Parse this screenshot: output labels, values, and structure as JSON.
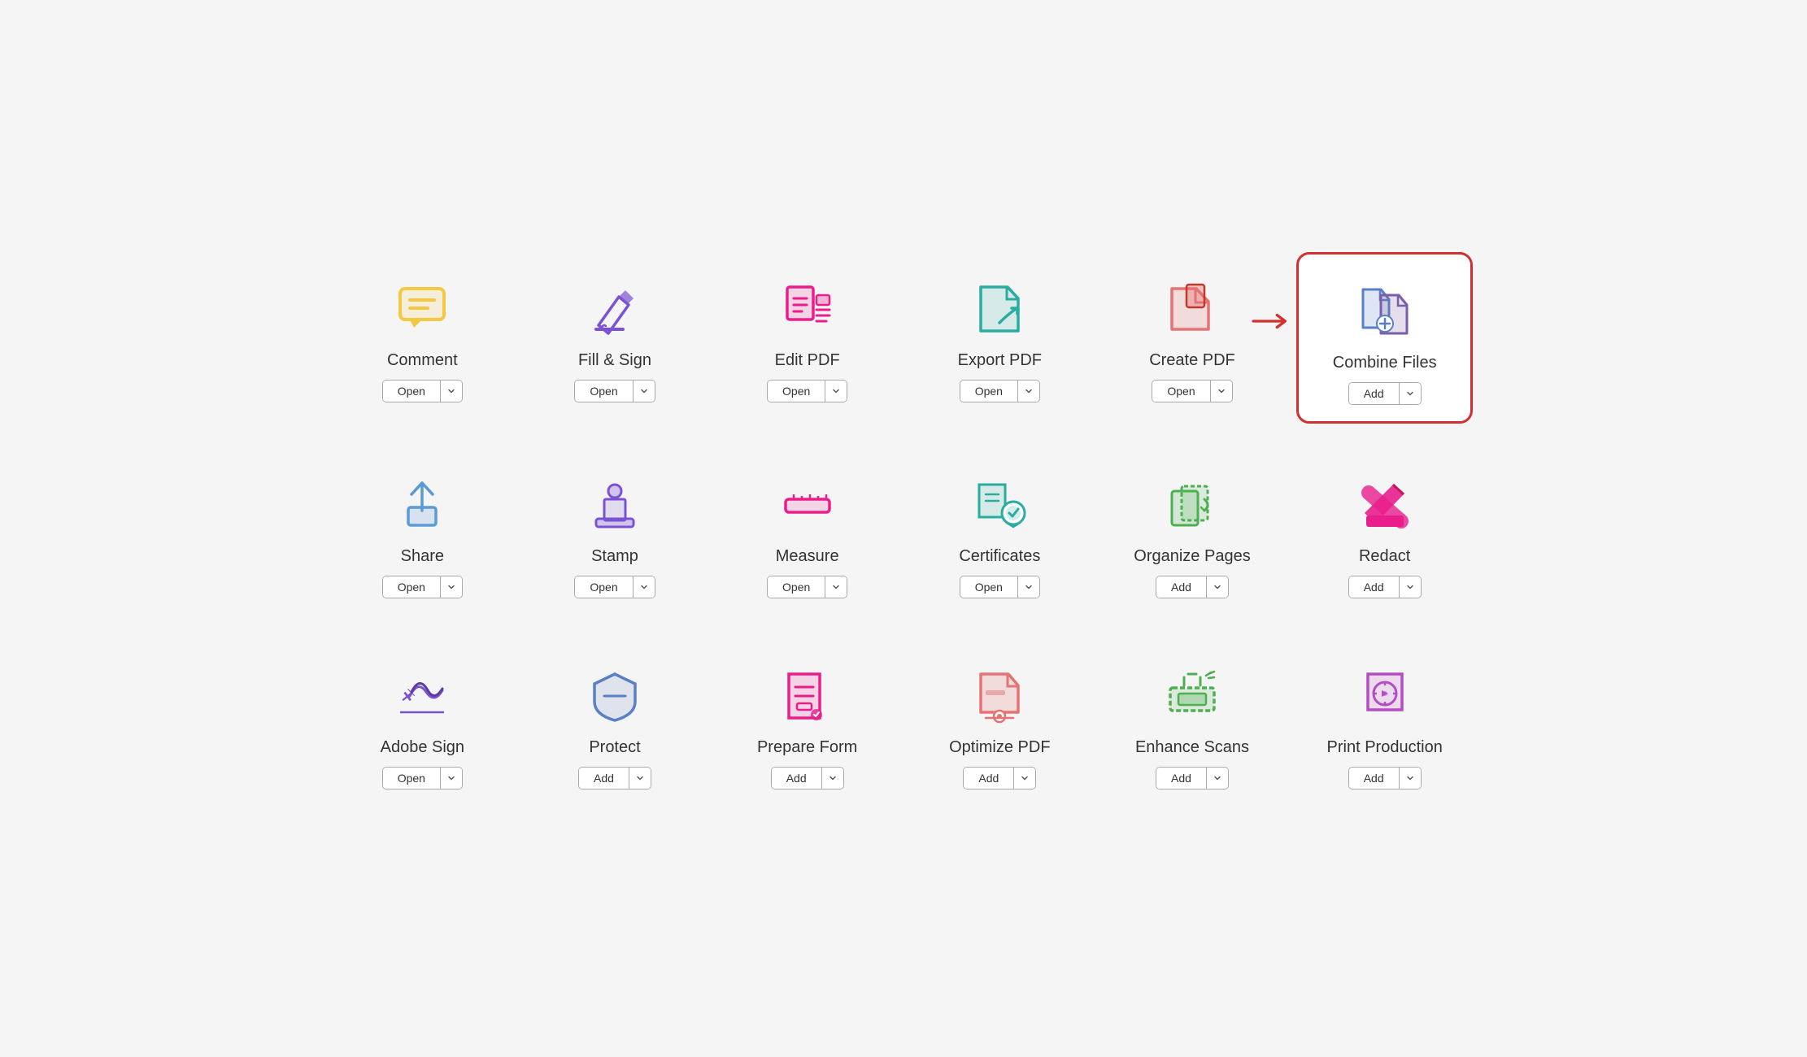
{
  "tools": [
    {
      "id": "comment",
      "label": "Comment",
      "button": "Open",
      "highlighted": false,
      "has_arrow": false,
      "icon_type": "comment"
    },
    {
      "id": "fill-sign",
      "label": "Fill & Sign",
      "button": "Open",
      "highlighted": false,
      "has_arrow": false,
      "icon_type": "fill-sign"
    },
    {
      "id": "edit-pdf",
      "label": "Edit PDF",
      "button": "Open",
      "highlighted": false,
      "has_arrow": false,
      "icon_type": "edit-pdf"
    },
    {
      "id": "export-pdf",
      "label": "Export PDF",
      "button": "Open",
      "highlighted": false,
      "has_arrow": false,
      "icon_type": "export-pdf"
    },
    {
      "id": "create-pdf",
      "label": "Create PDF",
      "button": "Open",
      "highlighted": false,
      "has_arrow": false,
      "icon_type": "create-pdf"
    },
    {
      "id": "combine-files",
      "label": "Combine Files",
      "button": "Add",
      "highlighted": true,
      "has_arrow": true,
      "icon_type": "combine-files"
    },
    {
      "id": "share",
      "label": "Share",
      "button": "Open",
      "highlighted": false,
      "has_arrow": false,
      "icon_type": "share"
    },
    {
      "id": "stamp",
      "label": "Stamp",
      "button": "Open",
      "highlighted": false,
      "has_arrow": false,
      "icon_type": "stamp"
    },
    {
      "id": "measure",
      "label": "Measure",
      "button": "Open",
      "highlighted": false,
      "has_arrow": false,
      "icon_type": "measure"
    },
    {
      "id": "certificates",
      "label": "Certificates",
      "button": "Open",
      "highlighted": false,
      "has_arrow": false,
      "icon_type": "certificates"
    },
    {
      "id": "organize-pages",
      "label": "Organize Pages",
      "button": "Add",
      "highlighted": false,
      "has_arrow": false,
      "icon_type": "organize-pages"
    },
    {
      "id": "redact",
      "label": "Redact",
      "button": "Add",
      "highlighted": false,
      "has_arrow": false,
      "icon_type": "redact"
    },
    {
      "id": "adobe-sign",
      "label": "Adobe Sign",
      "button": "Open",
      "highlighted": false,
      "has_arrow": false,
      "icon_type": "adobe-sign"
    },
    {
      "id": "protect",
      "label": "Protect",
      "button": "Add",
      "highlighted": false,
      "has_arrow": false,
      "icon_type": "protect"
    },
    {
      "id": "prepare-form",
      "label": "Prepare Form",
      "button": "Add",
      "highlighted": false,
      "has_arrow": false,
      "icon_type": "prepare-form"
    },
    {
      "id": "optimize-pdf",
      "label": "Optimize PDF",
      "button": "Add",
      "highlighted": false,
      "has_arrow": false,
      "icon_type": "optimize-pdf"
    },
    {
      "id": "enhance-scans",
      "label": "Enhance Scans",
      "button": "Add",
      "highlighted": false,
      "has_arrow": false,
      "icon_type": "enhance-scans"
    },
    {
      "id": "print-production",
      "label": "Print Production",
      "button": "Add",
      "highlighted": false,
      "has_arrow": false,
      "icon_type": "print-production"
    }
  ]
}
